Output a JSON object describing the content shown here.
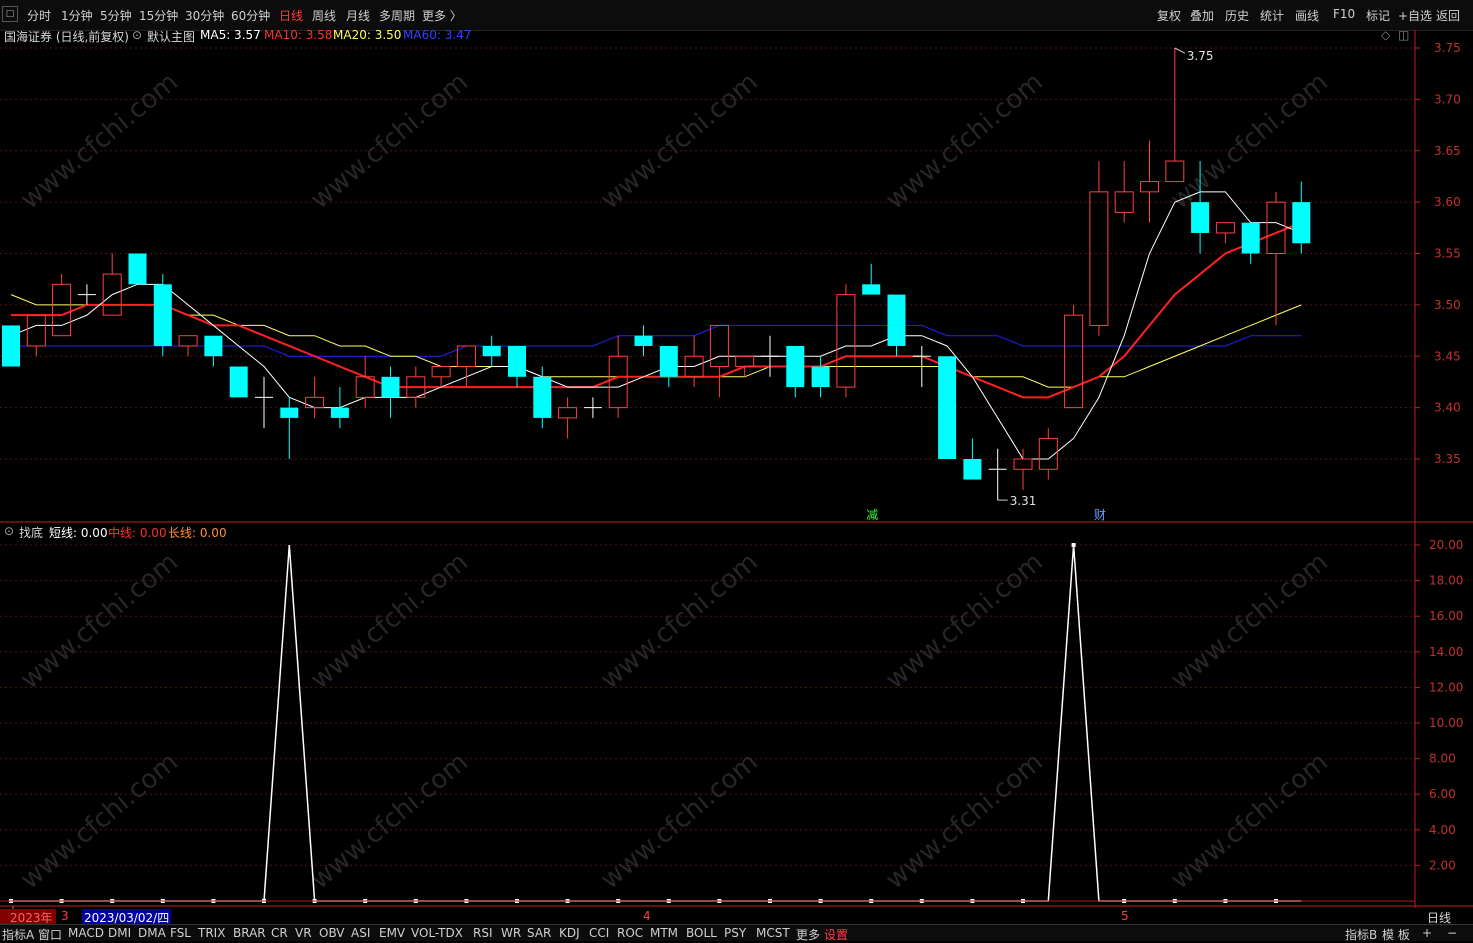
{
  "toolbar": {
    "left_items": [
      "分时",
      "1分钟",
      "5分钟",
      "15分钟",
      "30分钟",
      "60分钟",
      "日线",
      "周线",
      "月线",
      "多周期",
      "更多 〉"
    ],
    "active": "日线",
    "right_items": [
      "复权",
      "叠加",
      "历史",
      "统计",
      "画线",
      "F10",
      "标记",
      "+自选",
      "返回"
    ]
  },
  "main_title": {
    "stock": "国海证券 (日线,前复权)",
    "template": "默认主图",
    "ma5_label": "MA5: 3.57",
    "ma10_label": "MA10: 3.58",
    "ma20_label": "MA20: 3.50",
    "ma60_label": "MA60: 3.47"
  },
  "sub_title": {
    "name": "找底",
    "short_label": "短线: 0.00",
    "mid_label": "中线: 0.00",
    "long_label": "长线: 0.00"
  },
  "annotations": {
    "high_label": "3.75",
    "low_label": "3.31",
    "event1": "减",
    "event2": "财"
  },
  "price_axis_labels": [
    "3.75",
    "3.70",
    "3.65",
    "3.60",
    "3.55",
    "3.50",
    "3.45",
    "3.40",
    "3.35"
  ],
  "sub_axis_labels": [
    "20.00",
    "18.00",
    "16.00",
    "14.00",
    "12.00",
    "10.00",
    "8.00",
    "6.00",
    "4.00",
    "2.00"
  ],
  "datebar": {
    "year": "2023年",
    "month3": "3",
    "cursor_date": "2023/03/02/四",
    "month4": "4",
    "month5": "5",
    "period": "日线"
  },
  "bottom_tabs": [
    "指标A",
    "窗口",
    "MACD",
    "DMI",
    "DMA",
    "FSL",
    "TRIX",
    "BRAR",
    "CR",
    "VR",
    "OBV",
    "ASI",
    "EMV",
    "VOL-TDX",
    "RSI",
    "WR",
    "SAR",
    "KDJ",
    "CCI",
    "ROC",
    "MTM",
    "BOLL",
    "PSY",
    "MCST",
    "更多",
    "设置"
  ],
  "bottom_right": [
    "指标B",
    "模 板",
    "+",
    "−"
  ],
  "watermark": "www.cfchi.com",
  "colors": {
    "up": "#ff4040",
    "down": "#00ffff",
    "ma5": "#ffffff",
    "ma10": "#ff2020",
    "ma20": "#ffff60",
    "ma60": "#2020ff",
    "axis": "#c02020"
  },
  "chart_data": {
    "type": "candlestick",
    "series_name": "国海证券",
    "price_range": [
      3.3,
      3.77
    ],
    "candles": [
      [
        3.48,
        3.44,
        3.48,
        3.44
      ],
      [
        3.46,
        3.49,
        3.49,
        3.45
      ],
      [
        3.47,
        3.52,
        3.53,
        3.47
      ],
      [
        3.51,
        3.51,
        3.52,
        3.5
      ],
      [
        3.49,
        3.53,
        3.55,
        3.49
      ],
      [
        3.55,
        3.52,
        3.55,
        3.52
      ],
      [
        3.52,
        3.46,
        3.53,
        3.45
      ],
      [
        3.46,
        3.47,
        3.47,
        3.45
      ],
      [
        3.47,
        3.45,
        3.47,
        3.44
      ],
      [
        3.44,
        3.41,
        3.44,
        3.41
      ],
      [
        3.41,
        3.41,
        3.43,
        3.38
      ],
      [
        3.4,
        3.39,
        3.41,
        3.35
      ],
      [
        3.4,
        3.41,
        3.43,
        3.39
      ],
      [
        3.4,
        3.39,
        3.42,
        3.38
      ],
      [
        3.41,
        3.43,
        3.45,
        3.4
      ],
      [
        3.43,
        3.41,
        3.44,
        3.39
      ],
      [
        3.41,
        3.43,
        3.44,
        3.4
      ],
      [
        3.43,
        3.44,
        3.44,
        3.42
      ],
      [
        3.44,
        3.46,
        3.46,
        3.42
      ],
      [
        3.46,
        3.45,
        3.47,
        3.44
      ],
      [
        3.46,
        3.43,
        3.46,
        3.42
      ],
      [
        3.43,
        3.39,
        3.44,
        3.38
      ],
      [
        3.39,
        3.4,
        3.41,
        3.37
      ],
      [
        3.4,
        3.4,
        3.41,
        3.39
      ],
      [
        3.4,
        3.45,
        3.47,
        3.39
      ],
      [
        3.47,
        3.46,
        3.48,
        3.45
      ],
      [
        3.46,
        3.43,
        3.46,
        3.42
      ],
      [
        3.43,
        3.45,
        3.47,
        3.42
      ],
      [
        3.44,
        3.48,
        3.48,
        3.41
      ],
      [
        3.44,
        3.45,
        3.45,
        3.43
      ],
      [
        3.45,
        3.45,
        3.47,
        3.43
      ],
      [
        3.46,
        3.42,
        3.46,
        3.41
      ],
      [
        3.44,
        3.42,
        3.45,
        3.41
      ],
      [
        3.42,
        3.51,
        3.52,
        3.41
      ],
      [
        3.52,
        3.51,
        3.54,
        3.51
      ],
      [
        3.51,
        3.46,
        3.51,
        3.45
      ],
      [
        3.45,
        3.45,
        3.46,
        3.42
      ],
      [
        3.45,
        3.35,
        3.45,
        3.35
      ],
      [
        3.35,
        3.33,
        3.37,
        3.33
      ],
      [
        3.34,
        3.34,
        3.36,
        3.31
      ],
      [
        3.34,
        3.35,
        3.36,
        3.32
      ],
      [
        3.34,
        3.37,
        3.38,
        3.33
      ],
      [
        3.4,
        3.49,
        3.5,
        3.4
      ],
      [
        3.48,
        3.61,
        3.64,
        3.47
      ],
      [
        3.59,
        3.61,
        3.64,
        3.58
      ],
      [
        3.61,
        3.62,
        3.66,
        3.58
      ],
      [
        3.62,
        3.64,
        3.75,
        3.62
      ],
      [
        3.6,
        3.57,
        3.64,
        3.55
      ],
      [
        3.57,
        3.58,
        3.58,
        3.56
      ],
      [
        3.58,
        3.55,
        3.58,
        3.54
      ],
      [
        3.55,
        3.6,
        3.61,
        3.48
      ],
      [
        3.6,
        3.56,
        3.62,
        3.55
      ]
    ],
    "ma5": [
      3.47,
      3.48,
      3.48,
      3.49,
      3.51,
      3.52,
      3.52,
      3.5,
      3.48,
      3.46,
      3.44,
      3.41,
      3.4,
      3.4,
      3.41,
      3.41,
      3.41,
      3.42,
      3.43,
      3.44,
      3.44,
      3.43,
      3.42,
      3.42,
      3.42,
      3.43,
      3.44,
      3.44,
      3.45,
      3.45,
      3.45,
      3.45,
      3.45,
      3.46,
      3.46,
      3.47,
      3.47,
      3.46,
      3.43,
      3.39,
      3.35,
      3.35,
      3.37,
      3.41,
      3.47,
      3.55,
      3.6,
      3.61,
      3.61,
      3.58,
      3.58,
      3.57
    ],
    "ma10": [
      3.49,
      3.49,
      3.49,
      3.5,
      3.5,
      3.5,
      3.5,
      3.49,
      3.48,
      3.48,
      3.47,
      3.46,
      3.45,
      3.44,
      3.43,
      3.42,
      3.42,
      3.42,
      3.42,
      3.42,
      3.42,
      3.42,
      3.42,
      3.42,
      3.43,
      3.43,
      3.43,
      3.43,
      3.43,
      3.44,
      3.44,
      3.44,
      3.44,
      3.45,
      3.45,
      3.45,
      3.45,
      3.44,
      3.43,
      3.42,
      3.41,
      3.41,
      3.42,
      3.43,
      3.45,
      3.48,
      3.51,
      3.53,
      3.55,
      3.56,
      3.57,
      3.58
    ],
    "ma20": [
      3.51,
      3.5,
      3.5,
      3.5,
      3.5,
      3.5,
      3.5,
      3.49,
      3.49,
      3.48,
      3.48,
      3.47,
      3.47,
      3.46,
      3.46,
      3.45,
      3.45,
      3.44,
      3.44,
      3.44,
      3.44,
      3.43,
      3.43,
      3.43,
      3.43,
      3.43,
      3.43,
      3.43,
      3.43,
      3.43,
      3.44,
      3.44,
      3.44,
      3.44,
      3.44,
      3.44,
      3.44,
      3.44,
      3.43,
      3.43,
      3.43,
      3.42,
      3.42,
      3.43,
      3.43,
      3.44,
      3.45,
      3.46,
      3.47,
      3.48,
      3.49,
      3.5
    ],
    "ma60": [
      3.46,
      3.46,
      3.46,
      3.46,
      3.46,
      3.46,
      3.46,
      3.46,
      3.46,
      3.46,
      3.46,
      3.45,
      3.45,
      3.45,
      3.45,
      3.45,
      3.45,
      3.45,
      3.46,
      3.46,
      3.46,
      3.46,
      3.46,
      3.46,
      3.47,
      3.47,
      3.47,
      3.47,
      3.48,
      3.48,
      3.48,
      3.48,
      3.48,
      3.48,
      3.48,
      3.48,
      3.48,
      3.47,
      3.47,
      3.47,
      3.46,
      3.46,
      3.46,
      3.46,
      3.46,
      3.46,
      3.46,
      3.46,
      3.46,
      3.47,
      3.47,
      3.47
    ],
    "zhaodi_range": [
      0,
      21
    ],
    "zhaodi_values": [
      0,
      0,
      0,
      0,
      0,
      0,
      0,
      0,
      0,
      0,
      0,
      20,
      0,
      0,
      0,
      0,
      0,
      0,
      0,
      0,
      0,
      0,
      0,
      0,
      0,
      0,
      0,
      0,
      0,
      0,
      0,
      0,
      0,
      0,
      0,
      0,
      0,
      0,
      0,
      0,
      0,
      0,
      20,
      0,
      0,
      0,
      0,
      0,
      0,
      0,
      0,
      0
    ]
  }
}
